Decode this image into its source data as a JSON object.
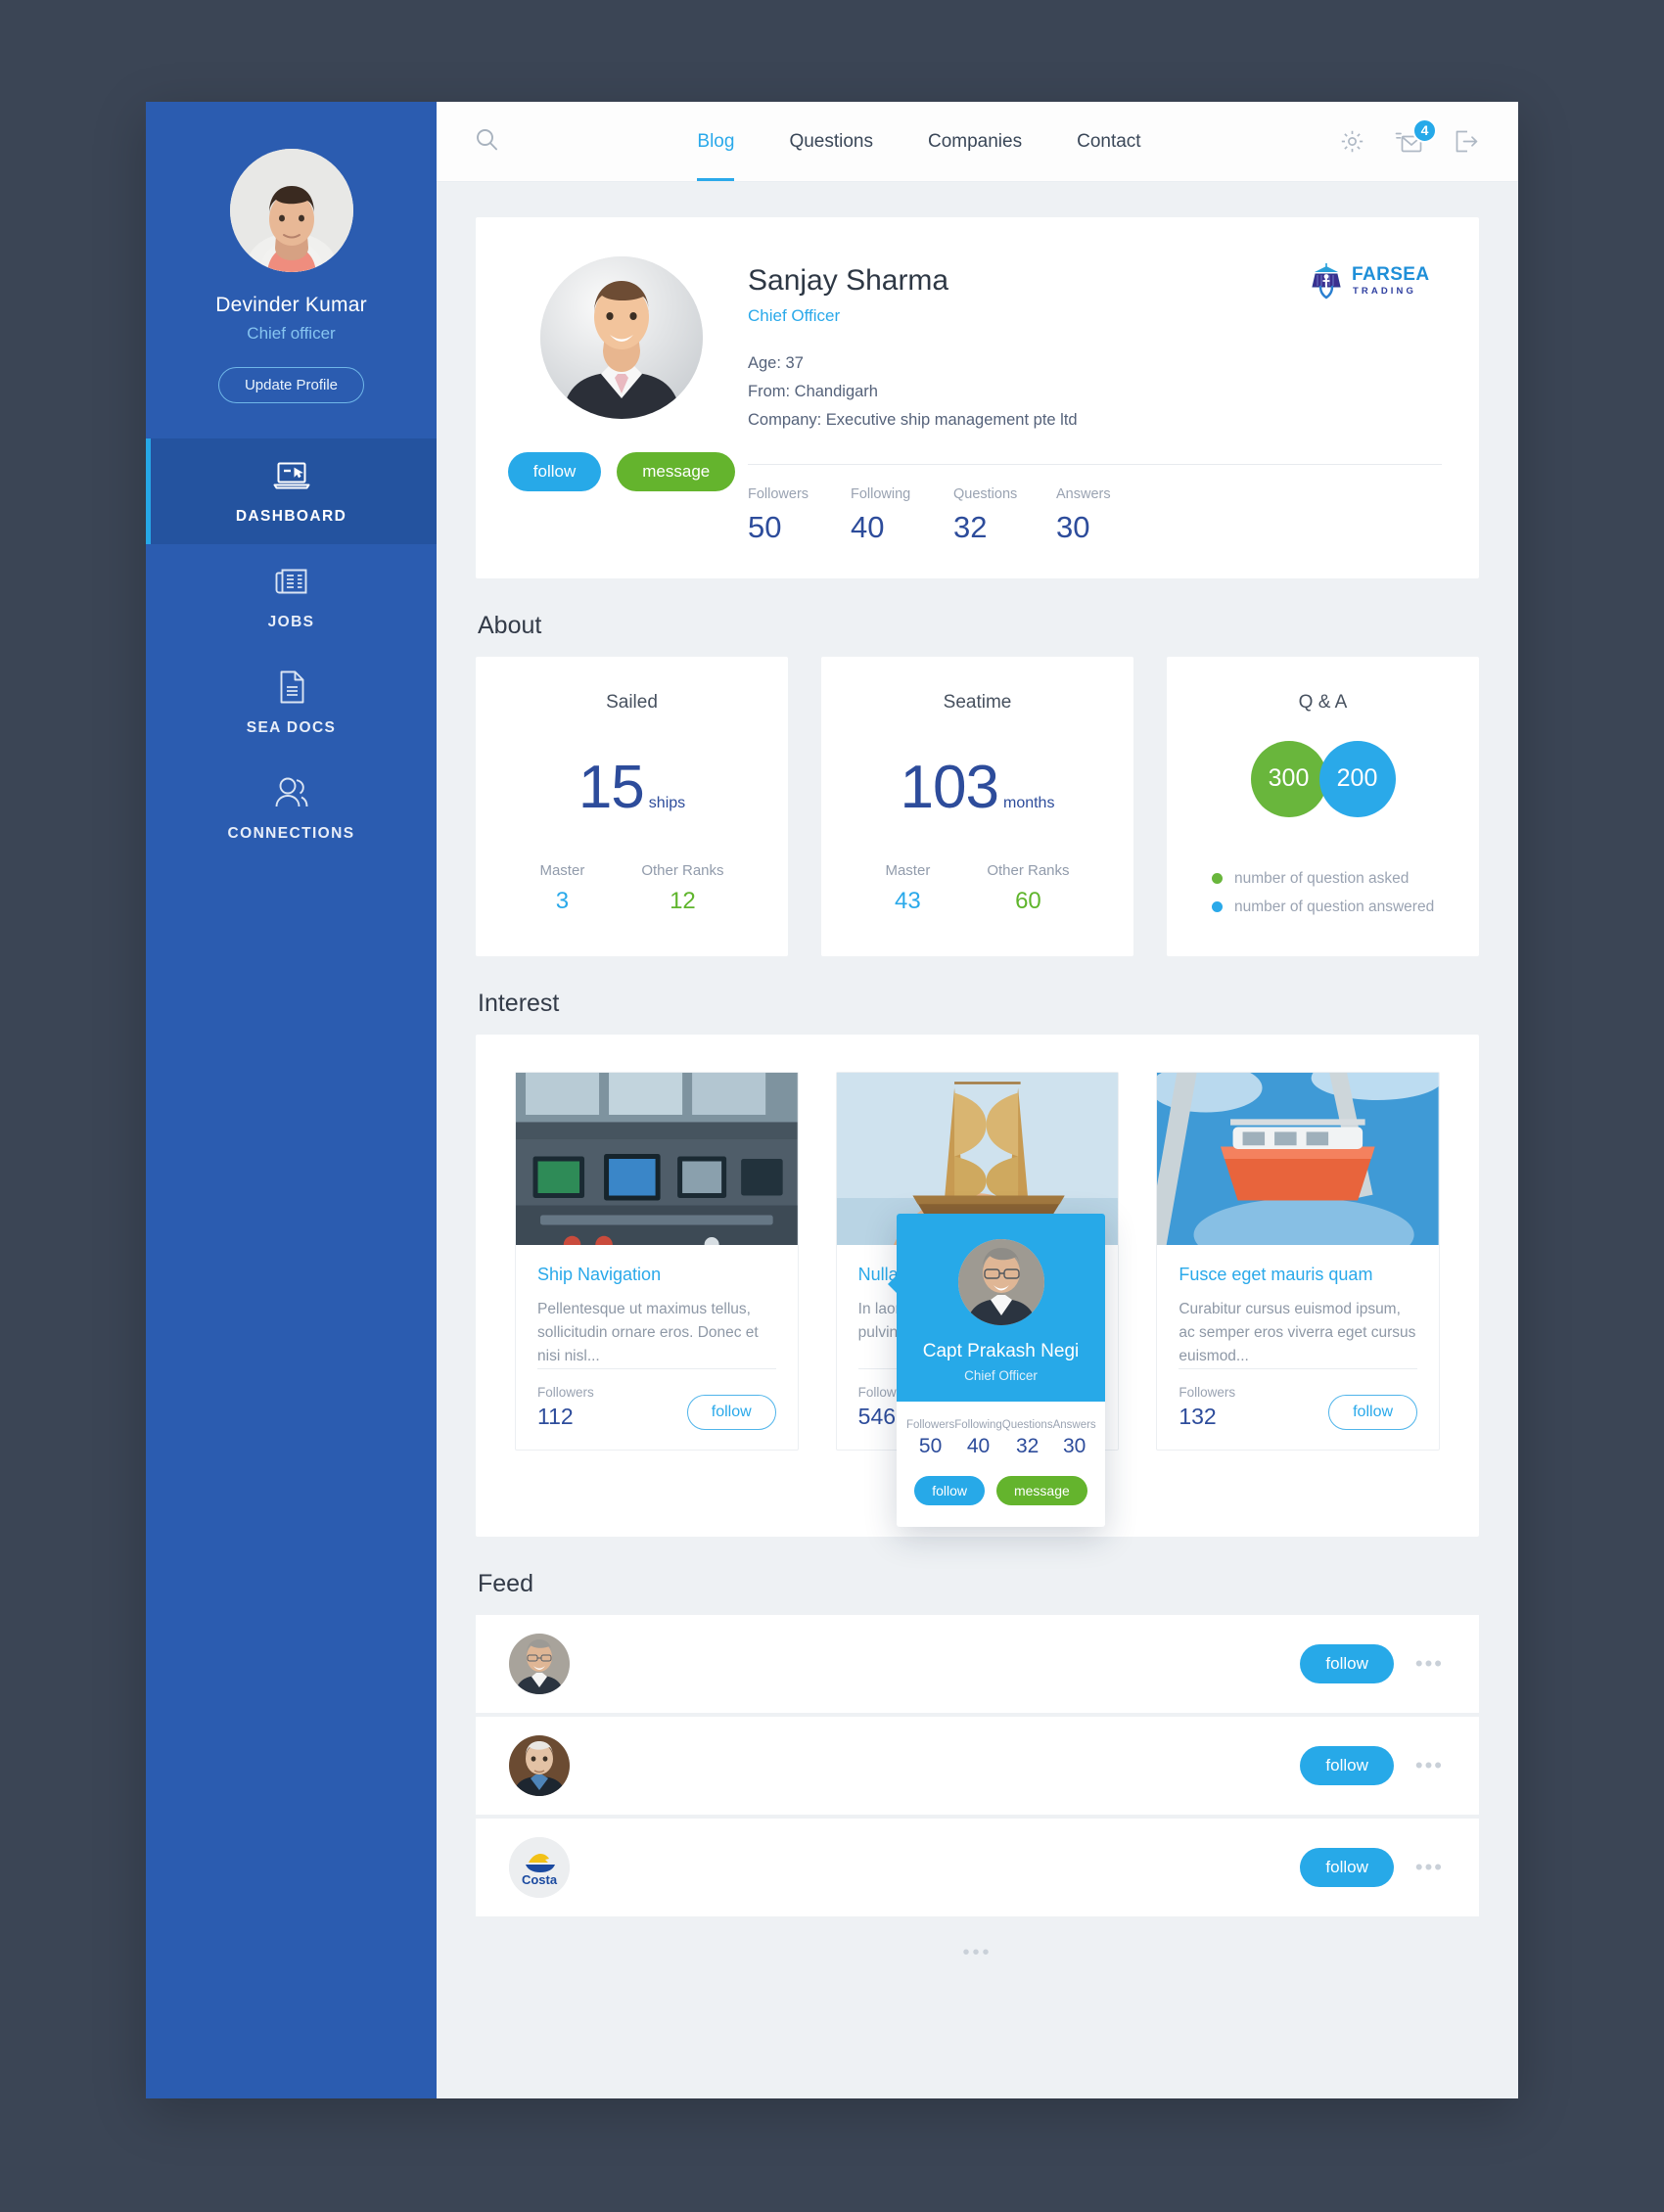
{
  "sidebar": {
    "user": {
      "name": "Devinder Kumar",
      "role": "Chief officer"
    },
    "update_button": "Update Profile",
    "items": [
      {
        "label": "DASHBOARD",
        "icon": "dashboard-icon",
        "active": true
      },
      {
        "label": "JOBS",
        "icon": "newspaper-icon",
        "active": false
      },
      {
        "label": "SEA DOCS",
        "icon": "document-icon",
        "active": false
      },
      {
        "label": "CONNECTIONS",
        "icon": "people-icon",
        "active": false
      }
    ]
  },
  "topbar": {
    "search_icon": "search-icon",
    "tabs": [
      {
        "label": "Blog",
        "active": true
      },
      {
        "label": "Questions",
        "active": false
      },
      {
        "label": "Companies",
        "active": false
      },
      {
        "label": "Contact",
        "active": false
      }
    ],
    "icons": [
      {
        "name": "gear-icon"
      },
      {
        "name": "mail-icon",
        "badge": "4"
      },
      {
        "name": "logout-icon"
      }
    ]
  },
  "profile": {
    "name": "Sanjay Sharma",
    "role": "Chief Officer",
    "age": "Age: 37",
    "from": "From: Chandigarh",
    "company": "Company: Executive ship management pte ltd",
    "follow_label": "follow",
    "message_label": "message",
    "logo": {
      "name": "FARSEA",
      "tagline": "T R A D I N G"
    },
    "stats": [
      {
        "label": "Followers",
        "value": "50"
      },
      {
        "label": "Following",
        "value": "40"
      },
      {
        "label": "Questions",
        "value": "32"
      },
      {
        "label": "Answers",
        "value": "30"
      }
    ]
  },
  "about": {
    "heading": "About",
    "cards": [
      {
        "title": "Sailed",
        "value": "15",
        "unit": "ships",
        "sub": [
          {
            "label": "Master",
            "value": "3",
            "color": "cyan"
          },
          {
            "label": "Other Ranks",
            "value": "12",
            "color": "green"
          }
        ]
      },
      {
        "title": "Seatime",
        "value": "103",
        "unit": "months",
        "sub": [
          {
            "label": "Master",
            "value": "43",
            "color": "cyan"
          },
          {
            "label": "Other Ranks",
            "value": "60",
            "color": "green"
          }
        ]
      }
    ],
    "qa": {
      "title": "Q & A",
      "asked": "300",
      "answered": "200",
      "legend": [
        {
          "label": "number of question asked",
          "color": "#69b63c"
        },
        {
          "label": "number of question answered",
          "color": "#2aa9e9"
        }
      ]
    }
  },
  "interest": {
    "heading": "Interest",
    "pager": "•••",
    "cards": [
      {
        "image": "ship-bridge-console-photo",
        "title": "Ship Navigation",
        "desc": "Pellentesque ut maximus tellus, sollicitudin ornare eros. Donec et nisi nisl...",
        "followers_label": "Followers",
        "followers": "112",
        "follow_label": "follow"
      },
      {
        "image": "model-sailing-ship-photo",
        "title": "Nullam ut sapien",
        "desc": "In laoreet suscipit mauris, eu pulvinar nisl accumsan in.",
        "followers_label": "Followers",
        "followers": "546",
        "follow_label": "follow"
      },
      {
        "image": "lifeboat-davit-photo",
        "title": "Fusce eget mauris quam",
        "desc": "Curabitur cursus euismod ipsum, ac semper eros viverra eget cursus euismod...",
        "followers_label": "Followers",
        "followers": "132",
        "follow_label": "follow"
      }
    ]
  },
  "feed": {
    "heading": "Feed",
    "pager": "•••",
    "rows": [
      {
        "avatar": "man-glasses-photo",
        "follow_label": "follow",
        "menu": "•••"
      },
      {
        "avatar": "older-man-photo",
        "follow_label": "follow",
        "menu": "•••"
      },
      {
        "avatar": "costa-logo",
        "follow_label": "follow",
        "menu": "•••"
      }
    ]
  },
  "popup": {
    "avatar": "capt-prakash-negi-photo",
    "name": "Capt Prakash Negi",
    "role": "Chief Officer",
    "stats": [
      {
        "label": "Followers",
        "value": "50"
      },
      {
        "label": "Following",
        "value": "40"
      },
      {
        "label": "Questions",
        "value": "32"
      },
      {
        "label": "Answers",
        "value": "30"
      }
    ],
    "follow_label": "follow",
    "message_label": "message"
  },
  "colors": {
    "sidebar": "#2b5cb0",
    "sidebar_active": "#24539f",
    "accent_blue": "#27a9e8",
    "accent_green": "#64b42d",
    "deep_blue": "#2d4c9b",
    "page_bg": "#3b4555"
  }
}
